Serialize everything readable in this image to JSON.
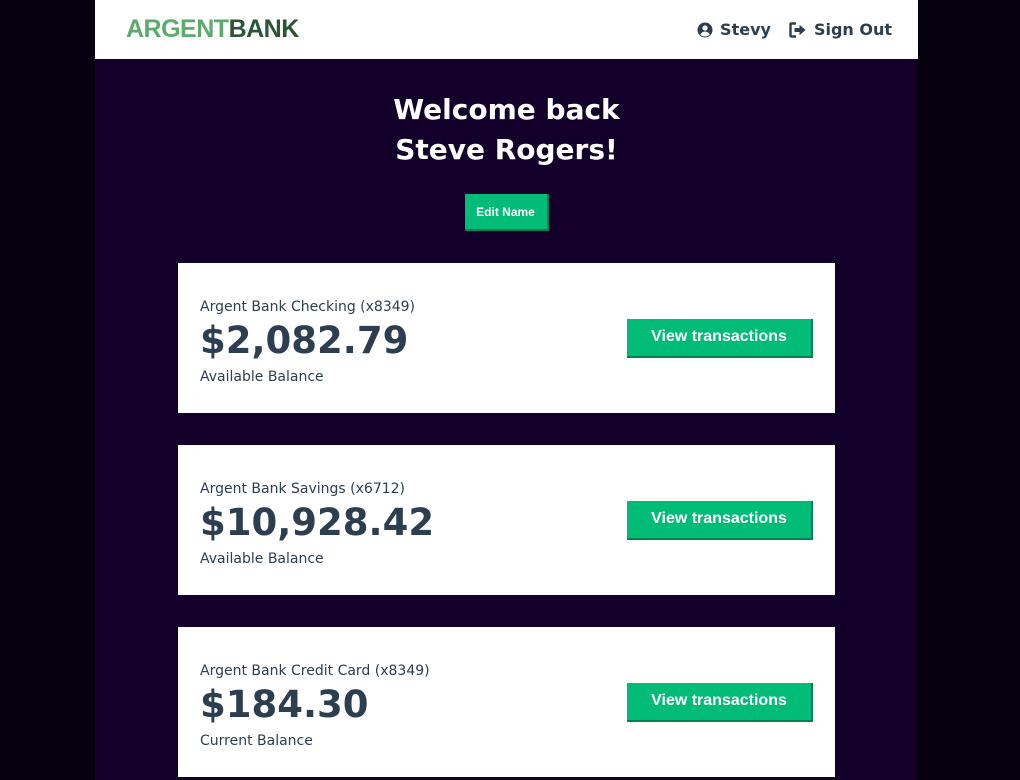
{
  "colors": {
    "background": "#12002b",
    "outer_background": "#05010f",
    "accent": "#00bc77",
    "text": "#2c3e50",
    "logo_light": "#5caa6c",
    "logo_dark": "#2c5536"
  },
  "nav": {
    "logo_part_1": "ARGENT",
    "logo_part_2": "BANK",
    "user_icon": "user-circle-icon",
    "user_name": "Stevy",
    "signout_icon": "sign-out-icon",
    "signout_label": "Sign Out"
  },
  "header": {
    "welcome_line_1": "Welcome back",
    "welcome_line_2": "Steve Rogers!",
    "edit_button": "Edit Name"
  },
  "accounts": [
    {
      "title": "Argent Bank Checking (x8349)",
      "amount": "$2,082.79",
      "description": "Available Balance",
      "button": "View transactions"
    },
    {
      "title": "Argent Bank Savings (x6712)",
      "amount": "$10,928.42",
      "description": "Available Balance",
      "button": "View transactions"
    },
    {
      "title": "Argent Bank Credit Card (x8349)",
      "amount": "$184.30",
      "description": "Current Balance",
      "button": "View transactions"
    }
  ]
}
